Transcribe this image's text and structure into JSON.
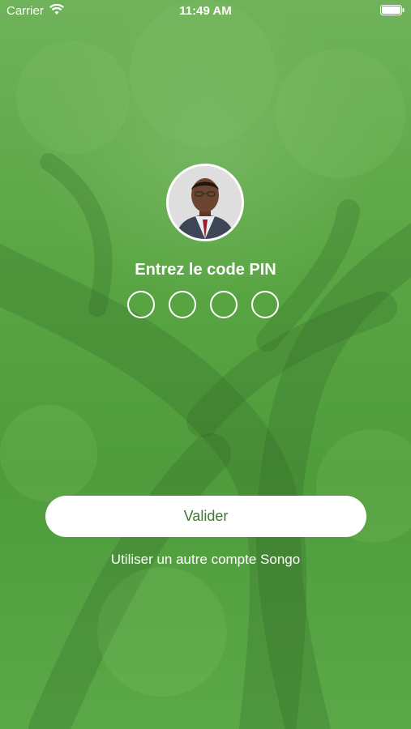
{
  "status_bar": {
    "carrier": "Carrier",
    "time": "11:49 AM",
    "wifi_icon": "wifi-icon",
    "battery_icon": "battery-icon"
  },
  "profile": {
    "avatar_icon": "user-photo"
  },
  "pin": {
    "title": "Entrez le code PIN",
    "digits_total": 4,
    "digits_entered": 0
  },
  "actions": {
    "submit_label": "Valider",
    "switch_account_label": "Utiliser un autre compte Songo"
  },
  "colors": {
    "background": "#5fa64a",
    "button_text": "#3b7a2a",
    "text": "#ffffff"
  }
}
